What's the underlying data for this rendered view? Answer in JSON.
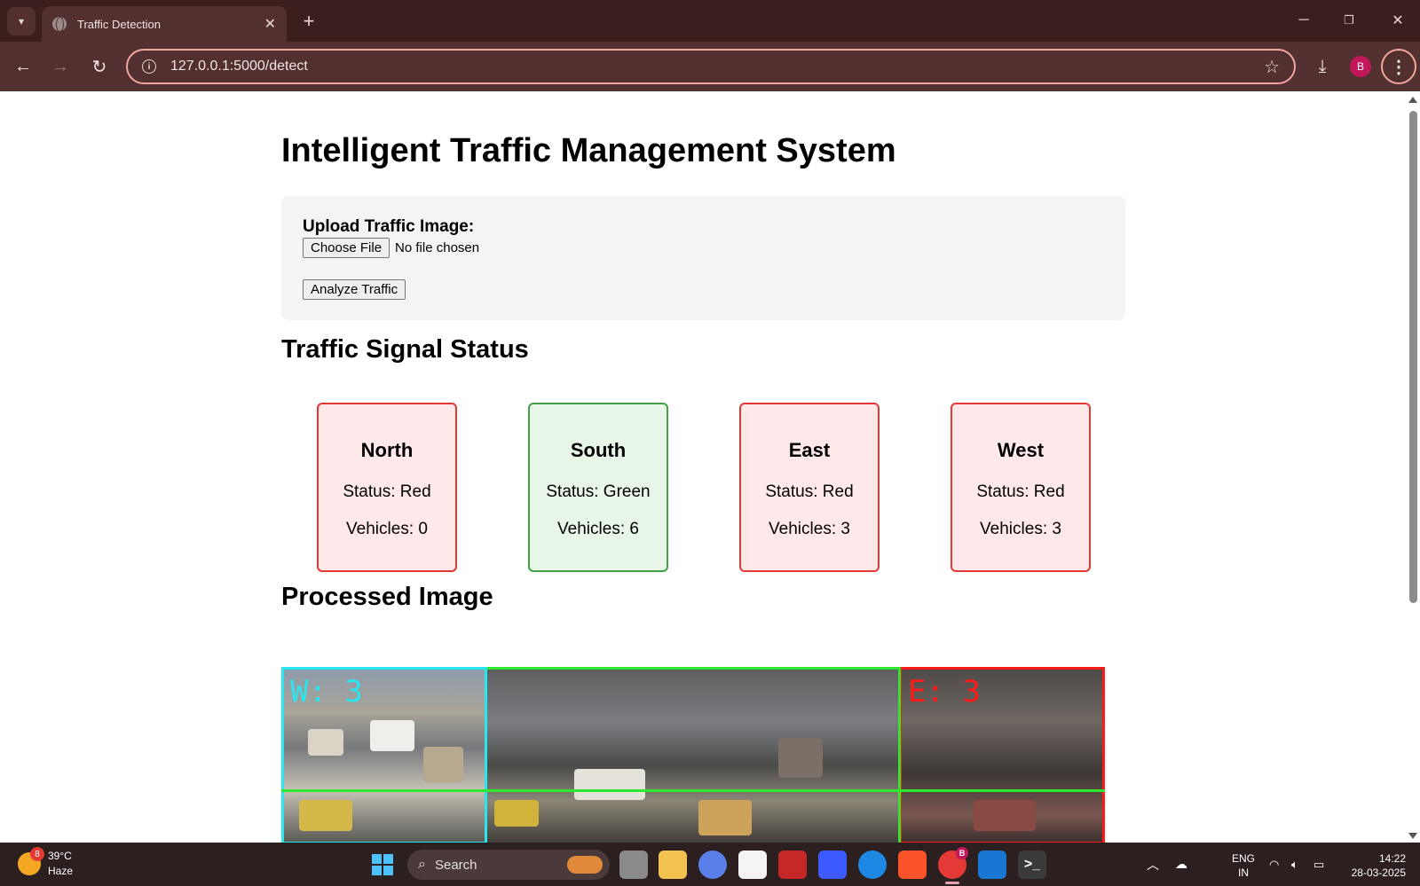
{
  "browser": {
    "tab_title": "Traffic Detection",
    "tab_close": "✕",
    "new_tab": "+",
    "url": "127.0.0.1:5000/detect",
    "profile_initial": "B",
    "window": {
      "minimize": "─",
      "restore": "❐",
      "close": "✕"
    },
    "icons": {
      "tab_list": "chevron-down-icon",
      "back": "back-arrow-icon",
      "forward": "forward-arrow-icon",
      "reload": "reload-icon",
      "site_info": "info-icon",
      "bookmark": "star-icon",
      "download": "download-icon",
      "menu": "kebab-menu-icon"
    }
  },
  "page": {
    "title": "Intelligent Traffic Management System",
    "upload": {
      "label": "Upload Traffic Image:",
      "choose_file": "Choose File",
      "file_status": "No file chosen",
      "analyze_button": "Analyze Traffic"
    },
    "signal_heading": "Traffic Signal Status",
    "signals": [
      {
        "direction": "North",
        "status_text": "Status: Red",
        "vehicles_text": "Vehicles: 0",
        "state": "red"
      },
      {
        "direction": "South",
        "status_text": "Status: Green",
        "vehicles_text": "Vehicles: 6",
        "state": "green"
      },
      {
        "direction": "East",
        "status_text": "Status: Red",
        "vehicles_text": "Vehicles: 3",
        "state": "red"
      },
      {
        "direction": "West",
        "status_text": "Status: Red",
        "vehicles_text": "Vehicles: 3",
        "state": "red"
      }
    ],
    "processed_heading": "Processed Image",
    "image_labels": {
      "west": "W: 3",
      "east": "E: 3"
    },
    "image_colors": {
      "west": "#29e6f0",
      "green_zone": "#2ee82e",
      "east": "#ff1a1a"
    }
  },
  "taskbar": {
    "weather": {
      "temp": "39°C",
      "condition": "Haze",
      "badge": "8"
    },
    "search_placeholder": "Search",
    "chrome_badge": "B",
    "language": {
      "line1": "ENG",
      "line2": "IN"
    },
    "time": "14:22",
    "date": "28-03-2025"
  },
  "colors": {
    "chrome_bg": "#3b1e1e",
    "toolbar_bg": "#52302f",
    "omnibox_border": "#f3a6a0",
    "red_card_bg": "#ffe8ea",
    "red_card_border": "#e53935",
    "green_card_bg": "#e8f6e8",
    "green_card_border": "#43a047"
  }
}
